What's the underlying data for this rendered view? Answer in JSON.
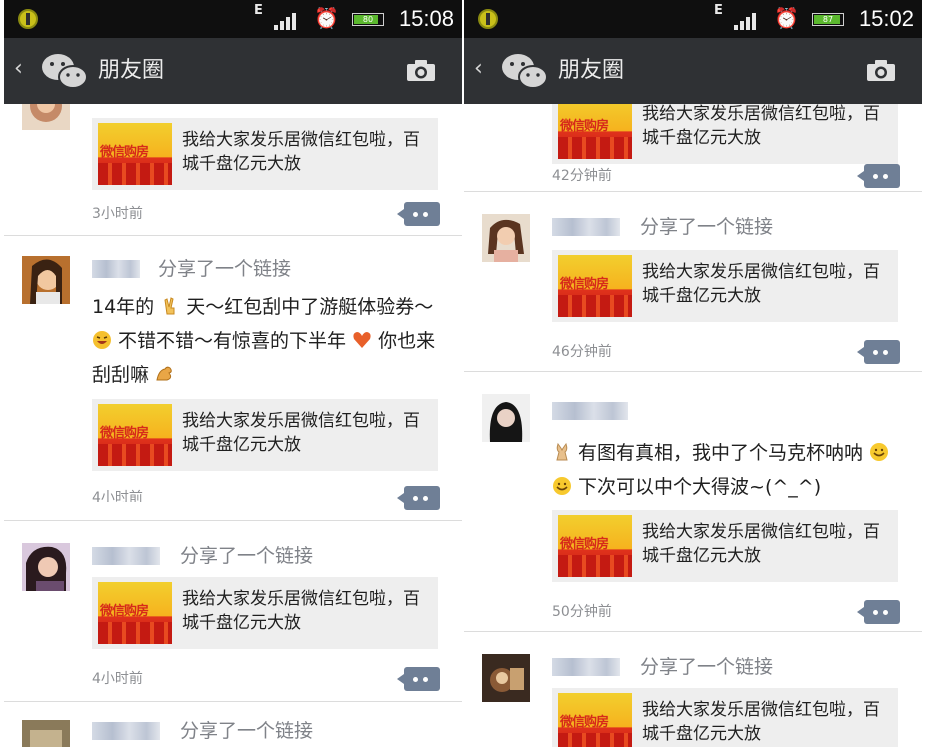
{
  "left": {
    "status_bar": {
      "network": "E",
      "time": "15:08",
      "battery": "80"
    },
    "title_bar": {
      "title": "朋友圈"
    },
    "posts": [
      {
        "time": "3小时前",
        "link": {
          "text": "我给大家发乐居微信红包啦，百城千盘亿元大放"
        }
      },
      {
        "shared": "分享了一个链接",
        "body": {
          "p1": "14年的",
          "p2": "天～红包刮中了游艇体验券～",
          "p3": "不错不错～有惊喜的下半年",
          "p4": "你也来刮刮嘛"
        },
        "link": {
          "text": "我给大家发乐居微信红包啦，百城千盘亿元大放"
        },
        "time": "4小时前"
      },
      {
        "shared": "分享了一个链接",
        "link": {
          "text": "我给大家发乐居微信红包啦，百城千盘亿元大放"
        },
        "time": "4小时前"
      },
      {
        "shared": "分享了一个链接"
      }
    ]
  },
  "right": {
    "status_bar": {
      "network": "E",
      "time": "15:02",
      "battery": "87"
    },
    "title_bar": {
      "title": "朋友圈"
    },
    "posts": [
      {
        "link": {
          "text": "我给大家发乐居微信红包啦，百城千盘亿元大放"
        },
        "time": "42分钟前"
      },
      {
        "shared": "分享了一个链接",
        "link": {
          "text": "我给大家发乐居微信红包啦，百城千盘亿元大放"
        },
        "time": "46分钟前"
      },
      {
        "body": {
          "p1": "有图有真相，我中了个马克杯呐呐",
          "p2": "下次可以中个大得波~(^_^)"
        },
        "link": {
          "text": "我给大家发乐居微信红包啦，百城千盘亿元大放"
        },
        "time": "50分钟前"
      },
      {
        "shared": "分享了一个链接",
        "link": {
          "text": "我给大家发乐居微信红包啦，百城千盘亿元大放"
        }
      }
    ]
  },
  "thumb_label": "微信购房",
  "icons": {
    "back": "chevron-left-icon",
    "logo": "wechat-icon",
    "camera": "camera-icon",
    "comment": "comment-icon",
    "signal": "signal-icon",
    "alarm": "alarm-icon",
    "battery": "battery-icon",
    "app": "notification-app-icon",
    "emoji": [
      "victory-hand-emoji",
      "grin-emoji",
      "heart-emoji",
      "muscle-emoji",
      "rabbit-emoji",
      "smile-emoji"
    ]
  },
  "colors": {
    "status_bar": "#0f0f0f",
    "title_bar": "#2f3134",
    "link_card": "#eeeeee",
    "comment_button": "#6f7f96",
    "time_text": "#8d8f93"
  }
}
